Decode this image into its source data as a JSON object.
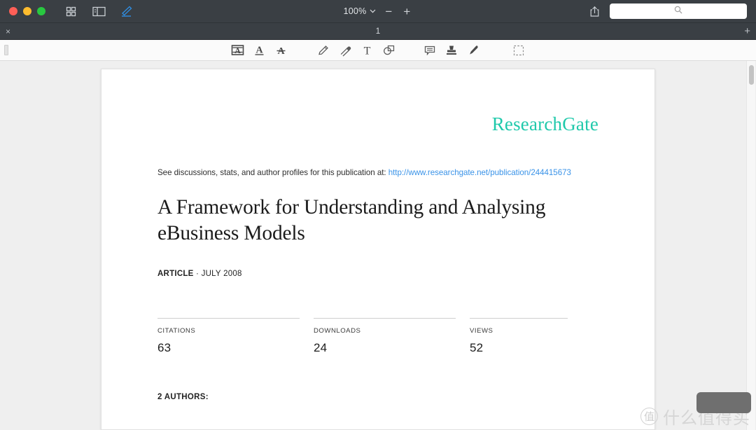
{
  "window": {
    "traffic_lights": [
      "close",
      "minimize",
      "zoom"
    ],
    "toolbar_icons": [
      "grid-view-icon",
      "sidebar-icon",
      "markup-pen-icon"
    ],
    "zoom": {
      "value": "100%",
      "zoom_out_label": "−",
      "zoom_in_label": "+"
    },
    "share_icon": "share-icon",
    "search": {
      "value": "",
      "placeholder": "",
      "icon": "search-icon"
    }
  },
  "tabbar": {
    "close_label": "×",
    "tab_title": "1",
    "add_label": "+"
  },
  "annotation_toolbar": {
    "tools": [
      {
        "name": "highlight-text-icon",
        "label": "Highlight"
      },
      {
        "name": "underline-text-icon",
        "label": "Underline"
      },
      {
        "name": "strikethrough-text-icon",
        "label": "Strikethrough"
      },
      {
        "name": "pencil-icon",
        "label": "Pencil"
      },
      {
        "name": "eraser-icon",
        "label": "Eraser"
      },
      {
        "name": "text-tool-icon",
        "label": "Text"
      },
      {
        "name": "shapes-icon",
        "label": "Shapes"
      },
      {
        "name": "comment-icon",
        "label": "Note"
      },
      {
        "name": "stamp-icon",
        "label": "Stamp"
      },
      {
        "name": "signature-pen-icon",
        "label": "Signature"
      },
      {
        "name": "selection-rectangle-icon",
        "label": "Select"
      }
    ]
  },
  "document": {
    "logo": "ResearchGate",
    "logo_color": "#20c9ab",
    "see_line_prefix": "See discussions, stats, and author profiles for this publication at: ",
    "see_line_url": "http://www.researchgate.net/publication/244415673",
    "link_color": "#3a93e8",
    "title": "A Framework for Understanding and Analysing eBusiness Models",
    "article_label": "ARTICLE",
    "article_date": " · JULY 2008",
    "stats": [
      {
        "label": "CITATIONS",
        "value": "63"
      },
      {
        "label": "DOWNLOADS",
        "value": "24"
      },
      {
        "label": "VIEWS",
        "value": "52"
      }
    ],
    "authors_heading": "2 AUTHORS:"
  },
  "watermark": {
    "logo_char": "值",
    "text": "什么值得买"
  }
}
